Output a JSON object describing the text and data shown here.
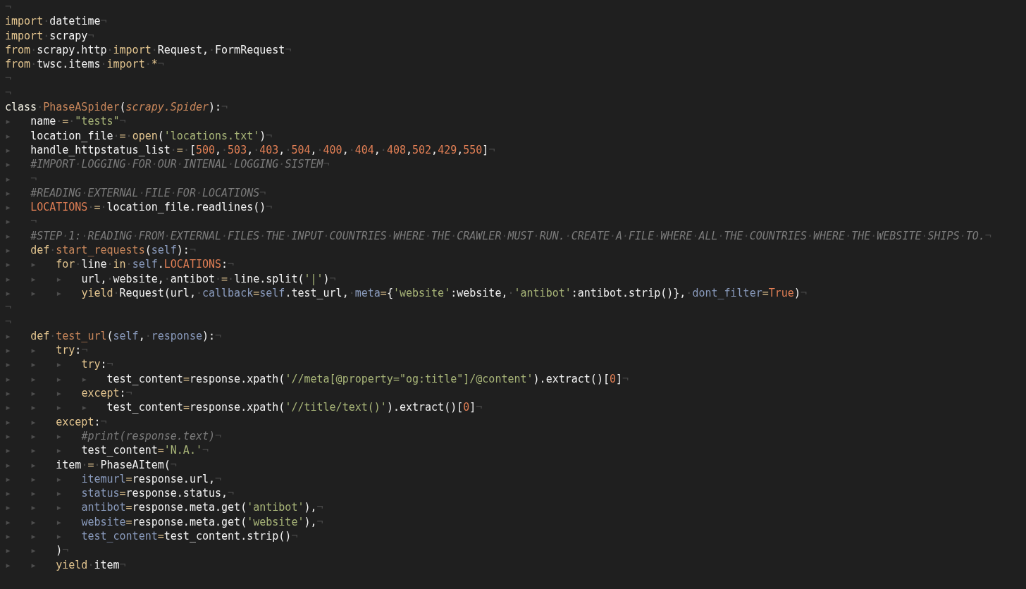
{
  "editor": {
    "lines": [
      {
        "eol": "¬"
      },
      {
        "tokens": [
          {
            "text": "import",
            "kind": "keyword"
          },
          {
            "text": "·datetime",
            "kind": "plain"
          }
        ],
        "eol": "¬"
      },
      {
        "tokens": [
          {
            "text": "import",
            "kind": "keyword"
          },
          {
            "text": "·scrapy",
            "kind": "plain"
          }
        ],
        "eol": "¬"
      },
      {
        "tokens": [
          {
            "text": "from",
            "kind": "keyword"
          },
          {
            "text": "·scrapy.http·",
            "kind": "plain"
          },
          {
            "text": "import",
            "kind": "keyword"
          },
          {
            "text": "·Request,·FormRequest",
            "kind": "plain"
          }
        ],
        "eol": "¬"
      },
      {
        "tokens": [
          {
            "text": "from",
            "kind": "keyword"
          },
          {
            "text": "·twsc.items·",
            "kind": "plain"
          },
          {
            "text": "import",
            "kind": "keyword"
          },
          {
            "text": "·*",
            "kind": "operator"
          }
        ],
        "eol": "¬"
      },
      {
        "eol": "¬"
      },
      {
        "eol": "¬"
      },
      {
        "tokens": [
          {
            "text": "class",
            "kind": "storage"
          },
          {
            "text": "·",
            "kind": "plain"
          },
          {
            "text": "PhaseASpider",
            "kind": "entity"
          },
          {
            "text": "(",
            "kind": "plain"
          },
          {
            "text": "scrapy.Spider",
            "kind": "inherited"
          },
          {
            "text": "):",
            "kind": "plain"
          }
        ],
        "eol": "¬"
      },
      {
        "indent": "▸   ",
        "tokens": [
          {
            "text": "name",
            "kind": "plain"
          },
          {
            "text": "·=·",
            "kind": "operator"
          },
          {
            "text": "\"tests\"",
            "kind": "string"
          }
        ],
        "eol": "¬"
      },
      {
        "indent": "▸   ",
        "tokens": [
          {
            "text": "location_file",
            "kind": "plain"
          },
          {
            "text": "·=·",
            "kind": "operator"
          },
          {
            "text": "open",
            "kind": "keyword"
          },
          {
            "text": "(",
            "kind": "plain"
          },
          {
            "text": "'locations.txt'",
            "kind": "string"
          },
          {
            "text": ")",
            "kind": "plain"
          }
        ],
        "eol": "¬"
      },
      {
        "indent": "▸   ",
        "tokens": [
          {
            "text": "handle_httpstatus_list",
            "kind": "plain"
          },
          {
            "text": "·=·",
            "kind": "operator"
          },
          {
            "text": "[",
            "kind": "plain"
          },
          {
            "text": "500",
            "kind": "number"
          },
          {
            "text": ",·",
            "kind": "plain"
          },
          {
            "text": "503",
            "kind": "number"
          },
          {
            "text": ",·",
            "kind": "plain"
          },
          {
            "text": "403",
            "kind": "number"
          },
          {
            "text": ",·",
            "kind": "plain"
          },
          {
            "text": "504",
            "kind": "number"
          },
          {
            "text": ",·",
            "kind": "plain"
          },
          {
            "text": "400",
            "kind": "number"
          },
          {
            "text": ",·",
            "kind": "plain"
          },
          {
            "text": "404",
            "kind": "number"
          },
          {
            "text": ",·",
            "kind": "plain"
          },
          {
            "text": "408",
            "kind": "number"
          },
          {
            "text": ",",
            "kind": "plain"
          },
          {
            "text": "502",
            "kind": "number"
          },
          {
            "text": ",",
            "kind": "plain"
          },
          {
            "text": "429",
            "kind": "number"
          },
          {
            "text": ",",
            "kind": "plain"
          },
          {
            "text": "550",
            "kind": "number"
          },
          {
            "text": "]",
            "kind": "plain"
          }
        ],
        "eol": "¬"
      },
      {
        "indent": "▸   ",
        "tokens": [
          {
            "text": "#IMPORT·LOGGING·FOR·OUR·INTENAL·LOGGING·SISTEM",
            "kind": "comment"
          }
        ],
        "eol": "¬"
      },
      {
        "indent": "▸   ",
        "eol": "¬"
      },
      {
        "indent": "▸   ",
        "tokens": [
          {
            "text": "#READING·EXTERNAL·FILE·FOR·LOCATIONS",
            "kind": "comment"
          }
        ],
        "eol": "¬"
      },
      {
        "indent": "▸   ",
        "tokens": [
          {
            "text": "LOCATIONS",
            "kind": "number"
          },
          {
            "text": "·=·",
            "kind": "operator"
          },
          {
            "text": "location_file.readlines()",
            "kind": "plain"
          }
        ],
        "eol": "¬"
      },
      {
        "indent": "▸   ",
        "eol": "¬"
      },
      {
        "indent": "▸   ",
        "tokens": [
          {
            "text": "#STEP·1:·READING·FROM·EXTERNAL·FILES·THE·INPUT·COUNTRIES·WHERE·THE·CRAWLER·MUST·RUN.·CREATE·A·FILE·WHERE·ALL·THE·COUNTRIES·WHERE·THE·WEBSITE·SHIPS·TO.",
            "kind": "comment"
          }
        ],
        "eol": "¬"
      },
      {
        "indent": "▸   ",
        "tokens": [
          {
            "text": "def",
            "kind": "keyword"
          },
          {
            "text": "·",
            "kind": "plain"
          },
          {
            "text": "start_requests",
            "kind": "entity"
          },
          {
            "text": "(",
            "kind": "plain"
          },
          {
            "text": "self",
            "kind": "variable"
          },
          {
            "text": "):",
            "kind": "plain"
          }
        ],
        "eol": "¬"
      },
      {
        "indent": "▸   ▸   ",
        "tokens": [
          {
            "text": "for",
            "kind": "keyword"
          },
          {
            "text": "·line·",
            "kind": "plain"
          },
          {
            "text": "in",
            "kind": "keyword"
          },
          {
            "text": "·",
            "kind": "plain"
          },
          {
            "text": "self",
            "kind": "variable"
          },
          {
            "text": ".",
            "kind": "plain"
          },
          {
            "text": "LOCATIONS",
            "kind": "number"
          },
          {
            "text": ":",
            "kind": "plain"
          }
        ],
        "eol": "¬"
      },
      {
        "indent": "▸   ▸   ▸   ",
        "tokens": [
          {
            "text": "url,·website,·antibot",
            "kind": "plain"
          },
          {
            "text": "·=·",
            "kind": "operator"
          },
          {
            "text": "line.split(",
            "kind": "plain"
          },
          {
            "text": "'|'",
            "kind": "string"
          },
          {
            "text": ")",
            "kind": "plain"
          }
        ],
        "eol": "¬"
      },
      {
        "indent": "▸   ▸   ▸   ",
        "tokens": [
          {
            "text": "yield",
            "kind": "keyword"
          },
          {
            "text": "·Request(url,·",
            "kind": "plain"
          },
          {
            "text": "callback",
            "kind": "variable"
          },
          {
            "text": "=",
            "kind": "operator"
          },
          {
            "text": "self",
            "kind": "variable"
          },
          {
            "text": ".test_url,·",
            "kind": "plain"
          },
          {
            "text": "meta",
            "kind": "variable"
          },
          {
            "text": "=",
            "kind": "operator"
          },
          {
            "text": "{",
            "kind": "plain"
          },
          {
            "text": "'website'",
            "kind": "string"
          },
          {
            "text": ":website,·",
            "kind": "plain"
          },
          {
            "text": "'antibot'",
            "kind": "string"
          },
          {
            "text": ":antibot.strip()},·",
            "kind": "plain"
          },
          {
            "text": "dont_filter",
            "kind": "variable"
          },
          {
            "text": "=",
            "kind": "operator"
          },
          {
            "text": "True",
            "kind": "number"
          },
          {
            "text": ")",
            "kind": "plain"
          }
        ],
        "eol": "¬"
      },
      {
        "eol": "¬"
      },
      {
        "eol": "¬"
      },
      {
        "indent": "▸   ",
        "tokens": [
          {
            "text": "def",
            "kind": "keyword"
          },
          {
            "text": "·",
            "kind": "plain"
          },
          {
            "text": "test_url",
            "kind": "entity"
          },
          {
            "text": "(",
            "kind": "plain"
          },
          {
            "text": "self",
            "kind": "variable"
          },
          {
            "text": ",·",
            "kind": "plain"
          },
          {
            "text": "response",
            "kind": "variable"
          },
          {
            "text": "):",
            "kind": "plain"
          }
        ],
        "eol": "¬"
      },
      {
        "indent": "▸   ▸   ",
        "tokens": [
          {
            "text": "try",
            "kind": "keyword"
          },
          {
            "text": ":",
            "kind": "plain"
          }
        ],
        "eol": "¬"
      },
      {
        "indent": "▸   ▸   ▸   ",
        "tokens": [
          {
            "text": "try",
            "kind": "keyword"
          },
          {
            "text": ":",
            "kind": "plain"
          }
        ],
        "eol": "¬"
      },
      {
        "indent": "▸   ▸   ▸   ▸   ",
        "tokens": [
          {
            "text": "test_content",
            "kind": "plain"
          },
          {
            "text": "=",
            "kind": "operator"
          },
          {
            "text": "response.xpath(",
            "kind": "plain"
          },
          {
            "text": "'//meta[@property=\"og:title\"]/@content'",
            "kind": "string"
          },
          {
            "text": ").extract()[",
            "kind": "plain"
          },
          {
            "text": "0",
            "kind": "number"
          },
          {
            "text": "]",
            "kind": "plain"
          }
        ],
        "eol": "¬"
      },
      {
        "indent": "▸   ▸   ▸   ",
        "tokens": [
          {
            "text": "except",
            "kind": "keyword"
          },
          {
            "text": ":",
            "kind": "plain"
          }
        ],
        "eol": "¬"
      },
      {
        "indent": "▸   ▸   ▸   ▸   ",
        "tokens": [
          {
            "text": "test_content",
            "kind": "plain"
          },
          {
            "text": "=",
            "kind": "operator"
          },
          {
            "text": "response.xpath(",
            "kind": "plain"
          },
          {
            "text": "'//title/text()'",
            "kind": "string"
          },
          {
            "text": ").extract()[",
            "kind": "plain"
          },
          {
            "text": "0",
            "kind": "number"
          },
          {
            "text": "]",
            "kind": "plain"
          }
        ],
        "eol": "¬"
      },
      {
        "indent": "▸   ▸   ",
        "tokens": [
          {
            "text": "except",
            "kind": "keyword"
          },
          {
            "text": ":",
            "kind": "plain"
          }
        ],
        "eol": "¬"
      },
      {
        "indent": "▸   ▸   ▸   ",
        "tokens": [
          {
            "text": "#print(response.text)",
            "kind": "comment"
          }
        ],
        "eol": "¬"
      },
      {
        "indent": "▸   ▸   ▸   ",
        "tokens": [
          {
            "text": "test_content",
            "kind": "plain"
          },
          {
            "text": "=",
            "kind": "operator"
          },
          {
            "text": "'N.A.'",
            "kind": "string"
          }
        ],
        "eol": "¬"
      },
      {
        "indent": "▸   ▸   ",
        "tokens": [
          {
            "text": "item",
            "kind": "plain"
          },
          {
            "text": "·=·",
            "kind": "operator"
          },
          {
            "text": "PhaseAItem(",
            "kind": "plain"
          }
        ],
        "eol": "¬"
      },
      {
        "indent": "▸   ▸   ▸   ",
        "tokens": [
          {
            "text": "itemurl",
            "kind": "variable"
          },
          {
            "text": "=",
            "kind": "operator"
          },
          {
            "text": "response.url,",
            "kind": "plain"
          }
        ],
        "eol": "¬"
      },
      {
        "indent": "▸   ▸   ▸   ",
        "tokens": [
          {
            "text": "status",
            "kind": "variable"
          },
          {
            "text": "=",
            "kind": "operator"
          },
          {
            "text": "response.status,",
            "kind": "plain"
          }
        ],
        "eol": "¬"
      },
      {
        "indent": "▸   ▸   ▸   ",
        "tokens": [
          {
            "text": "antibot",
            "kind": "variable"
          },
          {
            "text": "=",
            "kind": "operator"
          },
          {
            "text": "response.meta.get(",
            "kind": "plain"
          },
          {
            "text": "'antibot'",
            "kind": "string"
          },
          {
            "text": "),",
            "kind": "plain"
          }
        ],
        "eol": "¬"
      },
      {
        "indent": "▸   ▸   ▸   ",
        "tokens": [
          {
            "text": "website",
            "kind": "variable"
          },
          {
            "text": "=",
            "kind": "operator"
          },
          {
            "text": "response.meta.get(",
            "kind": "plain"
          },
          {
            "text": "'website'",
            "kind": "string"
          },
          {
            "text": "),",
            "kind": "plain"
          }
        ],
        "eol": "¬"
      },
      {
        "indent": "▸   ▸   ▸   ",
        "tokens": [
          {
            "text": "test_content",
            "kind": "variable"
          },
          {
            "text": "=",
            "kind": "operator"
          },
          {
            "text": "test_content.strip()",
            "kind": "plain"
          }
        ],
        "eol": "¬"
      },
      {
        "indent": "▸   ▸   ",
        "tokens": [
          {
            "text": ")",
            "kind": "plain"
          }
        ],
        "eol": "¬"
      },
      {
        "indent": "▸   ▸   ",
        "tokens": [
          {
            "text": "yield",
            "kind": "keyword"
          },
          {
            "text": "·item",
            "kind": "plain"
          }
        ],
        "eol": "¬"
      }
    ]
  }
}
